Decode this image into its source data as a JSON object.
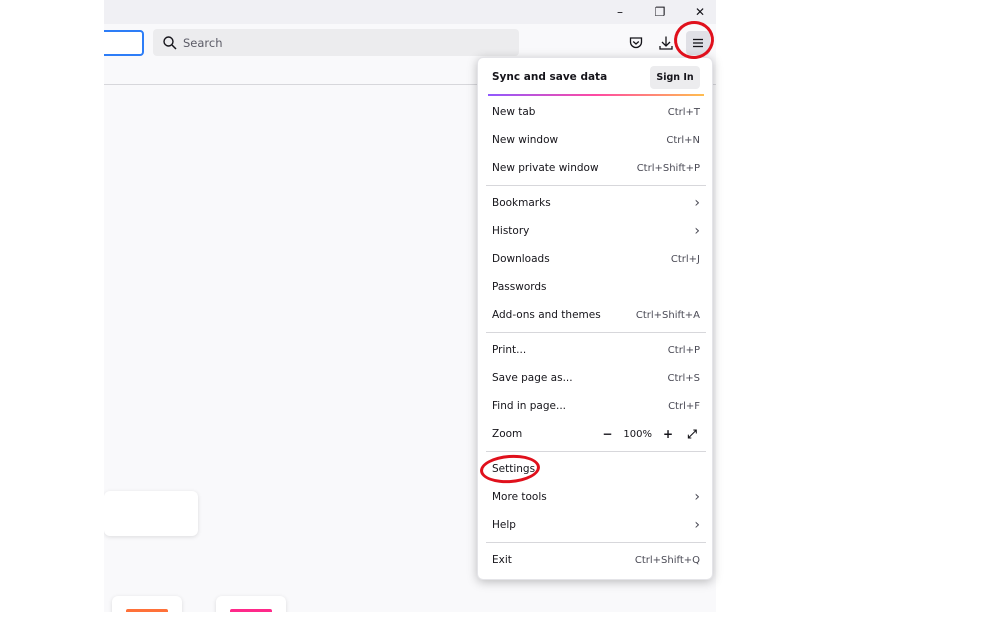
{
  "window": {
    "minimize": "–",
    "restore": "❐",
    "close": "✕"
  },
  "toolbar": {
    "search_placeholder": "Search"
  },
  "menu": {
    "sync_label": "Sync and save data",
    "sign_in": "Sign In",
    "items": [
      {
        "label": "New tab",
        "shortcut": "Ctrl+T"
      },
      {
        "label": "New window",
        "shortcut": "Ctrl+N"
      },
      {
        "label": "New private window",
        "shortcut": "Ctrl+Shift+P"
      },
      {
        "label": "Bookmarks",
        "shortcut": ""
      },
      {
        "label": "History",
        "shortcut": ""
      },
      {
        "label": "Downloads",
        "shortcut": "Ctrl+J"
      },
      {
        "label": "Passwords",
        "shortcut": ""
      },
      {
        "label": "Add-ons and themes",
        "shortcut": "Ctrl+Shift+A"
      },
      {
        "label": "Print...",
        "shortcut": "Ctrl+P"
      },
      {
        "label": "Save page as...",
        "shortcut": "Ctrl+S"
      },
      {
        "label": "Find in page...",
        "shortcut": "Ctrl+F"
      },
      {
        "label": "Zoom",
        "shortcut": ""
      },
      {
        "label": "Settings",
        "shortcut": ""
      },
      {
        "label": "More tools",
        "shortcut": ""
      },
      {
        "label": "Help",
        "shortcut": ""
      },
      {
        "label": "Exit",
        "shortcut": "Ctrl+Shift+Q"
      }
    ],
    "zoom": {
      "minus": "−",
      "value": "100%",
      "plus": "+",
      "fullscreen": "⤢"
    },
    "chevron": "›"
  },
  "colors": {
    "annotation": "#e0101c",
    "accent_gradient": [
      "#9059ff",
      "#ff4aa2",
      "#ffbd4f"
    ],
    "tile_orange": "#ff7139",
    "tile_pink": "#ff298a"
  }
}
